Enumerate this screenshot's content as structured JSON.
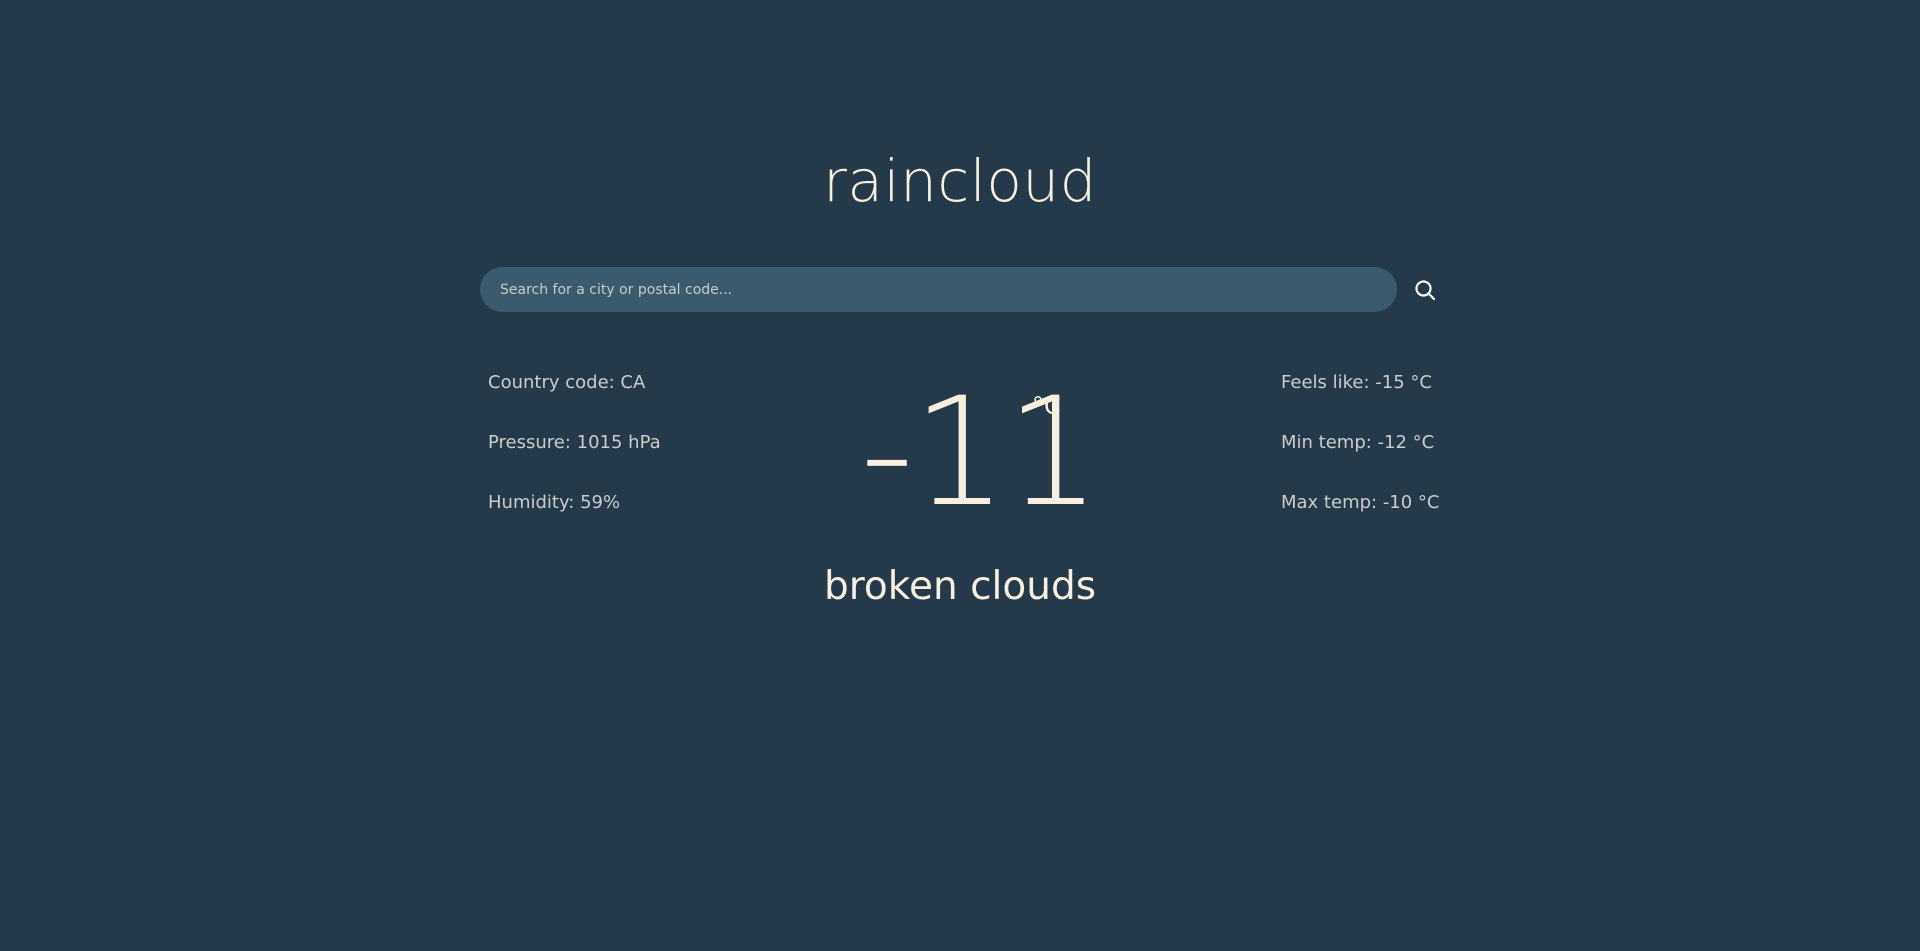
{
  "app": {
    "title": "raincloud"
  },
  "search": {
    "placeholder": "Search for a city or postal code...",
    "value": ""
  },
  "weather": {
    "temperature": "-11",
    "unit": "°C",
    "condition": "broken clouds",
    "left_stats": [
      "Country code: CA",
      "Pressure: 1015 hPa",
      "Humidity: 59%"
    ],
    "right_stats": [
      "Feels like: -15 °C",
      "Min temp: -12 °C",
      "Max temp: -10 °C"
    ]
  },
  "theme": {
    "background": "#243949",
    "search_bg": "#3a5b6d",
    "text": "#f7efdf",
    "muted_text": "#c9cdcc"
  },
  "icons": {
    "search": "search-icon"
  }
}
